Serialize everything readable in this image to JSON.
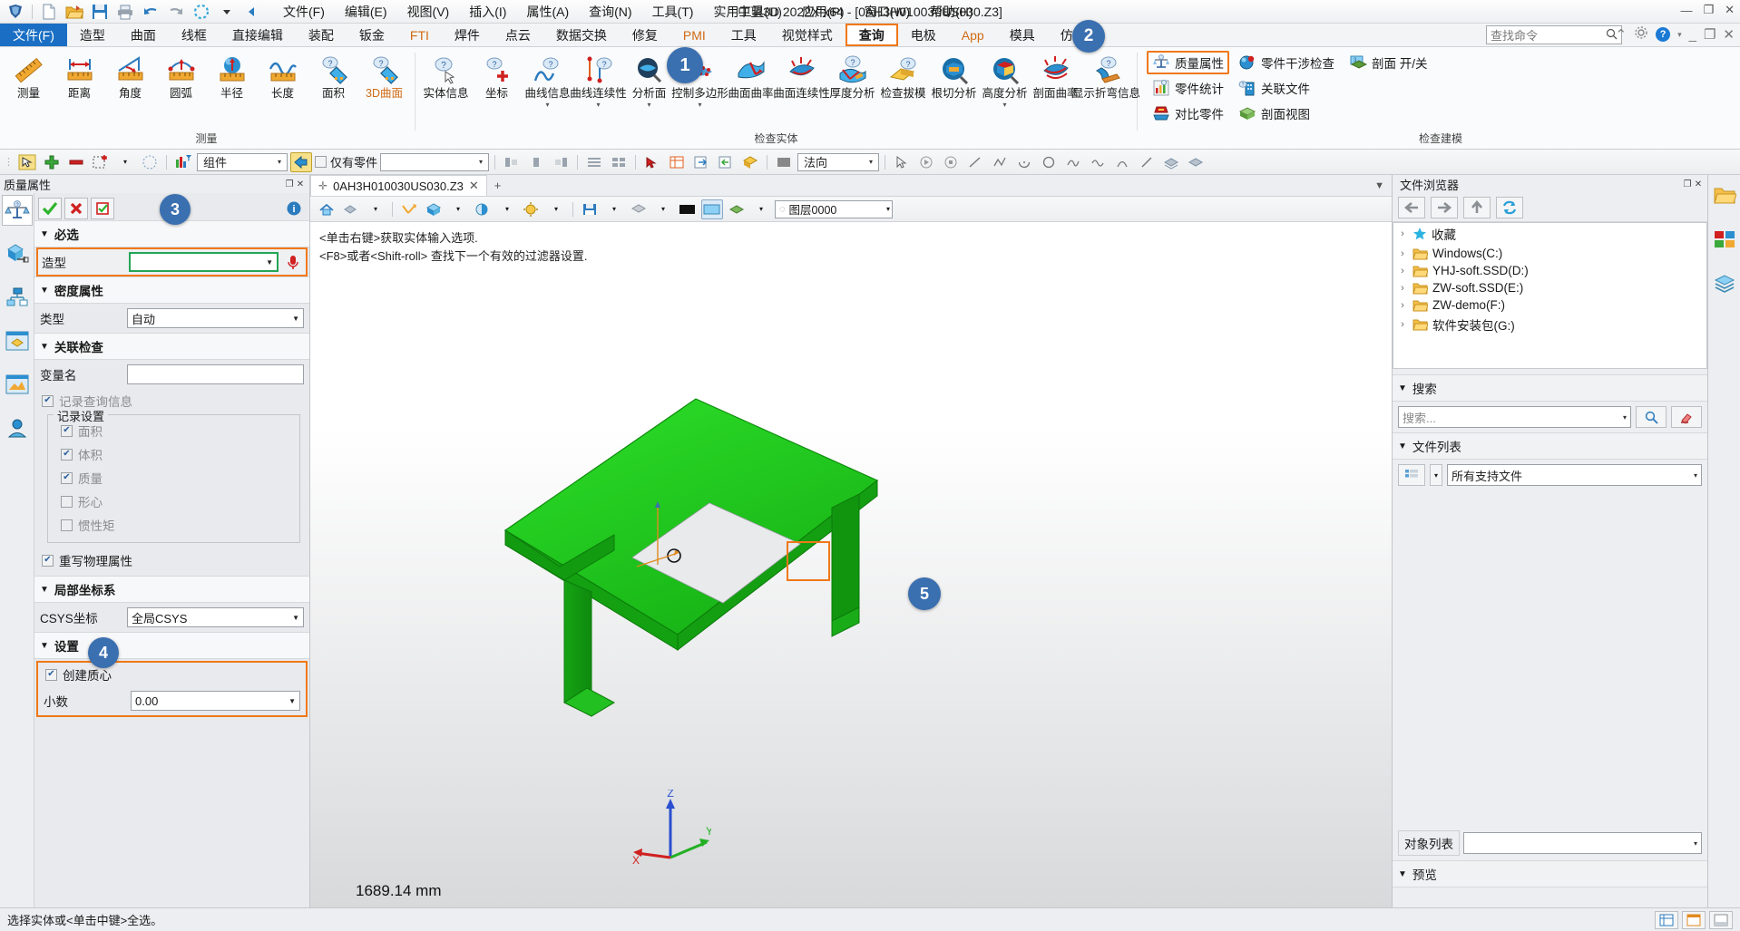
{
  "window": {
    "title": "中望3D 2022X x64 - [0AH3H010030US030.Z3]",
    "minimize": "—",
    "restore": "❐",
    "close": "✕"
  },
  "menubar": [
    {
      "label": "文件(F)"
    },
    {
      "label": "编辑(E)"
    },
    {
      "label": "视图(V)"
    },
    {
      "label": "插入(I)"
    },
    {
      "label": "属性(A)"
    },
    {
      "label": "查询(N)"
    },
    {
      "label": "工具(T)"
    },
    {
      "label": "实用工具(U)"
    },
    {
      "label": "应用(P)"
    },
    {
      "label": "窗口(W)"
    },
    {
      "label": "帮助(H)"
    }
  ],
  "quick_access": {
    "icons": [
      "app-logo-icon",
      "new-file-icon",
      "open-folder-icon",
      "save-icon",
      "print-icon",
      "undo-icon",
      "redo-icon",
      "regen-icon",
      "dropdown-icon",
      "collapse-arrow-icon"
    ]
  },
  "tabs": [
    {
      "label": "文件(F)",
      "state": "file"
    },
    {
      "label": "造型",
      "state": "normal"
    },
    {
      "label": "曲面",
      "state": "normal"
    },
    {
      "label": "线框",
      "state": "normal"
    },
    {
      "label": "直接编辑",
      "state": "normal"
    },
    {
      "label": "装配",
      "state": "normal"
    },
    {
      "label": "钣金",
      "state": "normal"
    },
    {
      "label": "FTI",
      "state": "accent"
    },
    {
      "label": "焊件",
      "state": "normal"
    },
    {
      "label": "点云",
      "state": "normal"
    },
    {
      "label": "数据交换",
      "state": "normal"
    },
    {
      "label": "修复",
      "state": "normal"
    },
    {
      "label": "PMI",
      "state": "accent"
    },
    {
      "label": "工具",
      "state": "normal"
    },
    {
      "label": "视觉样式",
      "state": "normal"
    },
    {
      "label": "查询",
      "state": "active"
    },
    {
      "label": "电极",
      "state": "normal"
    },
    {
      "label": "App",
      "state": "accent"
    },
    {
      "label": "模具",
      "state": "normal"
    },
    {
      "label": "仿真",
      "state": "normal"
    }
  ],
  "search": {
    "placeholder": "查找命令",
    "icon": "search-icon"
  },
  "ribbon": {
    "groups": [
      {
        "name": "测量",
        "buttons": [
          {
            "label": "测量",
            "icon": "ruler-icon"
          },
          {
            "label": "距离",
            "icon": "distance-icon"
          },
          {
            "label": "角度",
            "icon": "angle-icon"
          },
          {
            "label": "圆弧",
            "icon": "arc-icon"
          },
          {
            "label": "半径",
            "icon": "radius-icon"
          },
          {
            "label": "长度",
            "icon": "length-icon"
          },
          {
            "label": "面积",
            "icon": "area-icon"
          },
          {
            "label": "3D曲面",
            "icon": "surface3d-icon",
            "accent": true
          }
        ]
      },
      {
        "name": "检查实体",
        "buttons": [
          {
            "label": "实体信息",
            "icon": "entity-info-icon"
          },
          {
            "label": "坐标",
            "icon": "coordinate-icon"
          },
          {
            "label": "曲线信息",
            "icon": "curve-info-icon",
            "dropdown": true
          },
          {
            "label": "曲线连续性",
            "icon": "curve-continuity-icon",
            "dropdown": true
          },
          {
            "label": "分析面",
            "icon": "analyze-face-icon",
            "dropdown": true
          },
          {
            "label": "控制多边形",
            "icon": "control-polygon-icon",
            "dropdown": true
          },
          {
            "label": "曲面曲率",
            "icon": "surface-curvature-icon"
          },
          {
            "label": "曲面连续性",
            "icon": "surface-continuity-icon"
          },
          {
            "label": "厚度分析",
            "icon": "thickness-analysis-icon"
          },
          {
            "label": "检查拔模",
            "icon": "draft-check-icon"
          },
          {
            "label": "根切分析",
            "icon": "undercut-analysis-icon"
          },
          {
            "label": "高度分析",
            "icon": "height-analysis-icon",
            "dropdown": true
          },
          {
            "label": "剖面曲率",
            "icon": "section-curvature-icon"
          },
          {
            "label": "显示折弯信息",
            "icon": "bend-info-icon"
          }
        ]
      }
    ],
    "right_group": {
      "name": "检查建模",
      "col1": [
        {
          "label": "质量属性",
          "icon": "mass-properties-icon",
          "highlight": true
        },
        {
          "label": "零件统计",
          "icon": "part-statistics-icon"
        },
        {
          "label": "对比零件",
          "icon": "compare-part-icon"
        }
      ],
      "col2": [
        {
          "label": "零件干涉检查",
          "icon": "interference-check-icon"
        },
        {
          "label": "关联文件",
          "icon": "linked-file-icon"
        },
        {
          "label": "剖面视图",
          "icon": "section-view-icon"
        }
      ],
      "col3": [
        {
          "label": "剖面 开/关",
          "icon": "section-toggle-icon"
        }
      ]
    }
  },
  "toolbar2": {
    "component_combo": "组件",
    "only_parts": "仅有零件",
    "normal_combo": "法向",
    "icons": [
      "pick-filter-icon",
      "add-icon",
      "remove-icon",
      "select-box-icon",
      "dropdown-icon",
      "deselect-icon",
      "filter-color-icon",
      "import-icon"
    ]
  },
  "left_panel": {
    "title": "质量属性",
    "form_buttons": [
      {
        "name": "ok-button",
        "icon": "check-icon"
      },
      {
        "name": "cancel-button",
        "icon": "x-icon"
      },
      {
        "name": "apply-button",
        "icon": "apply-icon"
      },
      {
        "name": "info-button",
        "icon": "info-icon"
      }
    ],
    "sections": {
      "required": {
        "title": "必选",
        "shape_label": "造型",
        "shape_value": "",
        "mic_icon": "pick-point-icon"
      },
      "density": {
        "title": "密度属性",
        "type_label": "类型",
        "type_value": "自动"
      },
      "link_check": {
        "title": "关联检查",
        "varname_label": "变量名",
        "varname_value": "",
        "record_query": {
          "label": "记录查询信息",
          "checked": true,
          "disabled": true
        },
        "record_settings_legend": "记录设置",
        "options": [
          {
            "label": "面积",
            "checked": true
          },
          {
            "label": "体积",
            "checked": true
          },
          {
            "label": "质量",
            "checked": true
          },
          {
            "label": "形心",
            "checked": false
          },
          {
            "label": "惯性矩",
            "checked": false
          }
        ],
        "overwrite": {
          "label": "重写物理属性",
          "checked": true
        }
      },
      "local_csys": {
        "title": "局部坐标系",
        "csys_label": "CSYS坐标",
        "csys_value": "全局CSYS"
      },
      "settings": {
        "title": "设置",
        "create_centroid": {
          "label": "创建质心",
          "checked": true
        },
        "decimal_label": "小数",
        "decimal_value": "0.00"
      }
    }
  },
  "center": {
    "doc_tab": "0AH3H010030US030.Z3",
    "layer_combo": "图层0000",
    "hints": [
      "<单击右键>获取实体输入选项.",
      "<F8>或者<Shift-roll> 查找下一个有效的过滤器设置."
    ],
    "dimension": "1689.14 mm",
    "axis_labels": {
      "x": "X",
      "y": "Y",
      "z": "Z"
    }
  },
  "right_panel": {
    "title": "文件浏览器",
    "nav_icons": [
      "back-icon",
      "forward-icon",
      "up-icon",
      "refresh-icon"
    ],
    "tree": [
      {
        "label": "收藏",
        "icon": "star-icon"
      },
      {
        "label": "Windows(C:)",
        "icon": "folder-icon"
      },
      {
        "label": "YHJ-soft.SSD(D:)",
        "icon": "folder-icon"
      },
      {
        "label": "ZW-soft.SSD(E:)",
        "icon": "folder-icon"
      },
      {
        "label": "ZW-demo(F:)",
        "icon": "folder-icon"
      },
      {
        "label": "软件安装包(G:)",
        "icon": "folder-icon"
      }
    ],
    "search_section": "搜索",
    "search_placeholder": "搜索...",
    "filelist_section": "文件列表",
    "filetype_value": "所有支持文件",
    "object_list_label": "对象列表",
    "preview_section": "预览"
  },
  "status": {
    "text": "选择实体或<单击中键>全选。"
  },
  "markers": [
    "1",
    "2",
    "3",
    "4",
    "5"
  ],
  "colors": {
    "accent_orange": "#f07818",
    "marker_blue": "#3a6fb0",
    "model_green": "#22c421",
    "tab_blue": "#1a6fc4",
    "field_green": "#23a455"
  }
}
